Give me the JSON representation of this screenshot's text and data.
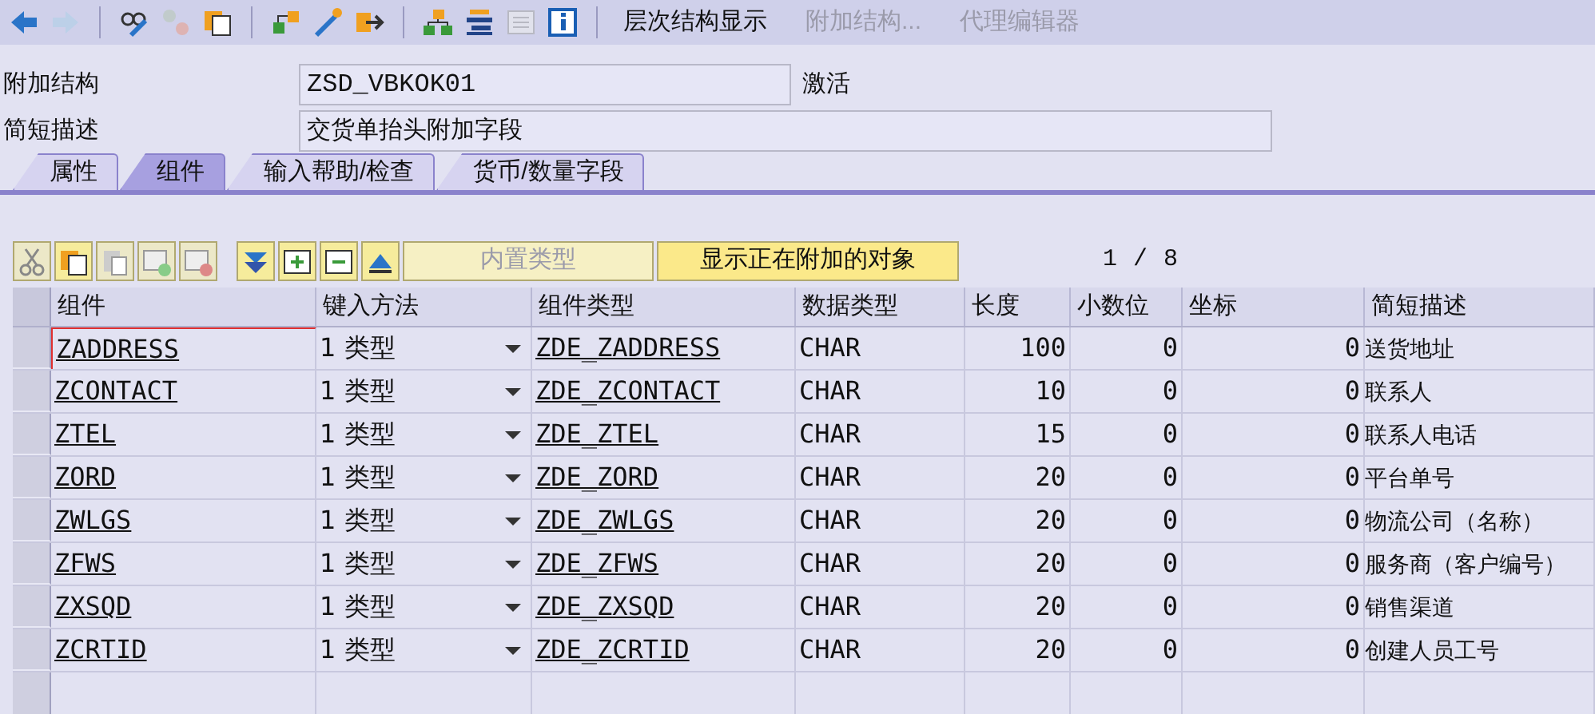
{
  "toolbar": {
    "icons": [
      {
        "kind": "back",
        "disabled": false
      },
      {
        "kind": "forward",
        "disabled": true
      },
      {
        "kind": "sep"
      },
      {
        "kind": "glasses",
        "disabled": false
      },
      {
        "kind": "swap",
        "disabled": true
      },
      {
        "kind": "copy",
        "disabled": false
      },
      {
        "kind": "sep"
      },
      {
        "kind": "connect",
        "disabled": false
      },
      {
        "kind": "wand",
        "disabled": false
      },
      {
        "kind": "export",
        "disabled": false
      },
      {
        "kind": "sep"
      },
      {
        "kind": "tree",
        "disabled": false
      },
      {
        "kind": "stack",
        "disabled": false
      },
      {
        "kind": "form",
        "disabled": true
      },
      {
        "kind": "info",
        "disabled": false
      },
      {
        "kind": "sep"
      }
    ],
    "buttons": [
      {
        "label": "层次结构显示",
        "disabled": false
      },
      {
        "label": "附加结构...",
        "disabled": true
      },
      {
        "label": "代理编辑器",
        "disabled": true
      }
    ]
  },
  "fields": [
    {
      "label": "附加结构",
      "value": "ZSD_VBKOK01",
      "status": "激活"
    },
    {
      "label": "简短描述",
      "value": "交货单抬头附加字段"
    }
  ],
  "tabs": [
    {
      "label": "属性",
      "selected": false
    },
    {
      "label": "组件",
      "selected": true
    },
    {
      "label": "输入帮助/检查",
      "selected": false
    },
    {
      "label": "货币/数量字段",
      "selected": false
    }
  ],
  "table_toolbar": {
    "icons": [
      {
        "kind": "cut",
        "disabled": true
      },
      {
        "kind": "copy",
        "disabled": false
      },
      {
        "kind": "paste",
        "disabled": true
      },
      {
        "kind": "insert-row",
        "disabled": true
      },
      {
        "kind": "delete-row",
        "disabled": true
      },
      {
        "kind": "sep"
      },
      {
        "kind": "filter",
        "disabled": false
      },
      {
        "kind": "expand",
        "disabled": false
      },
      {
        "kind": "collapse",
        "disabled": false
      },
      {
        "kind": "up",
        "disabled": false
      }
    ],
    "buttons": [
      {
        "label": "内置类型",
        "disabled": true
      },
      {
        "label": "显示正在附加的对象",
        "disabled": false
      }
    ],
    "page": "1",
    "separator": "/",
    "total": "8"
  },
  "table": {
    "columns": [
      "组件",
      "键入方法",
      "组件类型",
      "数据类型",
      "长度",
      "小数位",
      "坐标",
      "简短描述"
    ],
    "rows": [
      {
        "component": "ZADDRESS",
        "method": "1 类型",
        "type": "ZDE_ZADDRESS",
        "data_type": "CHAR",
        "length": "100",
        "decimals": "0",
        "coordinate": "0",
        "description": "送货地址",
        "focused": true
      },
      {
        "component": "ZCONTACT",
        "method": "1 类型",
        "type": "ZDE_ZCONTACT",
        "data_type": "CHAR",
        "length": "10",
        "decimals": "0",
        "coordinate": "0",
        "description": "联系人",
        "focused": false
      },
      {
        "component": "ZTEL",
        "method": "1 类型",
        "type": "ZDE_ZTEL",
        "data_type": "CHAR",
        "length": "15",
        "decimals": "0",
        "coordinate": "0",
        "description": "联系人电话",
        "focused": false
      },
      {
        "component": "ZORD",
        "method": "1 类型",
        "type": "ZDE_ZORD",
        "data_type": "CHAR",
        "length": "20",
        "decimals": "0",
        "coordinate": "0",
        "description": "平台单号",
        "focused": false
      },
      {
        "component": "ZWLGS",
        "method": "1 类型",
        "type": "ZDE_ZWLGS",
        "data_type": "CHAR",
        "length": "20",
        "decimals": "0",
        "coordinate": "0",
        "description": "物流公司（名称）",
        "focused": false
      },
      {
        "component": "ZFWS",
        "method": "1 类型",
        "type": "ZDE_ZFWS",
        "data_type": "CHAR",
        "length": "20",
        "decimals": "0",
        "coordinate": "0",
        "description": "服务商（客户编号）",
        "focused": false
      },
      {
        "component": "ZXSQD",
        "method": "1 类型",
        "type": "ZDE_ZXSQD",
        "data_type": "CHAR",
        "length": "20",
        "decimals": "0",
        "coordinate": "0",
        "description": "销售渠道",
        "focused": false
      },
      {
        "component": "ZCRTID",
        "method": "1 类型",
        "type": "ZDE_ZCRTID",
        "data_type": "CHAR",
        "length": "20",
        "decimals": "0",
        "coordinate": "0",
        "description": "创建人员工号",
        "focused": false
      }
    ]
  }
}
